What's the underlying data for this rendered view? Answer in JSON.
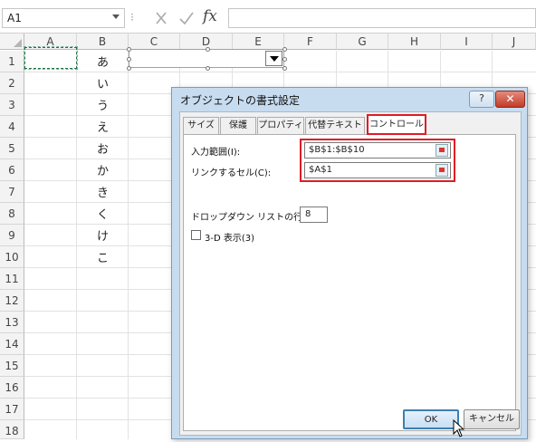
{
  "formula_bar": {
    "name_box": "A1",
    "separator": "⁝",
    "fx_label": "fx",
    "formula": ""
  },
  "columns": [
    "A",
    "B",
    "C",
    "D",
    "E",
    "F",
    "G",
    "H",
    "I",
    "J"
  ],
  "rows": [
    "1",
    "2",
    "3",
    "4",
    "5",
    "6",
    "7",
    "8",
    "9",
    "10",
    "11",
    "12",
    "13",
    "14",
    "15",
    "16",
    "17",
    "18"
  ],
  "column_b_values": [
    "あ",
    "い",
    "う",
    "え",
    "お",
    "か",
    "き",
    "く",
    "け",
    "こ"
  ],
  "dialog": {
    "title": "オブジェクトの書式設定",
    "help_label": "?",
    "close_label": "✕",
    "tabs": [
      "サイズ",
      "保護",
      "プロパティ",
      "代替テキスト",
      "コントロール"
    ],
    "active_tab": "コントロール",
    "input_range_label": "入力範囲(I):",
    "input_range_value": "$B$1:$B$10",
    "cell_link_label": "リンクするセル(C):",
    "cell_link_value": "$A$1",
    "dropdown_lines_label": "ドロップダウン リストの行数(D):",
    "dropdown_lines_value": "8",
    "three_d_label": "3-D 表示(3)",
    "three_d_checked": false,
    "ok_label": "OK",
    "cancel_label": "キャンセル"
  },
  "colors": {
    "highlight_red": "#e01b24",
    "selection_green": "#217346",
    "dialog_frame": "#c8dcf0"
  }
}
